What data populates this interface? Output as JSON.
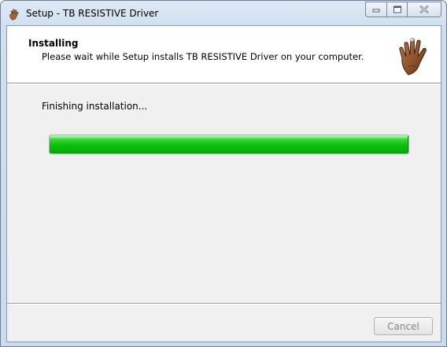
{
  "window": {
    "title": "Setup - TB RESISTIVE Driver"
  },
  "caption_buttons": {
    "minimize": "minimize-icon",
    "maximize": "maximize-icon",
    "close": "close-icon"
  },
  "header": {
    "title": "Installing",
    "subtitle": "Please wait while Setup installs TB RESISTIVE Driver on your computer.",
    "logo": "hand-logo"
  },
  "status": {
    "text": "Finishing installation..."
  },
  "progress": {
    "fraction": 1.0
  },
  "footer": {
    "cancel_label": "Cancel",
    "cancel_enabled": false
  },
  "colors": {
    "progress_green": "#0bbf0b",
    "disabled_text": "#838383"
  }
}
